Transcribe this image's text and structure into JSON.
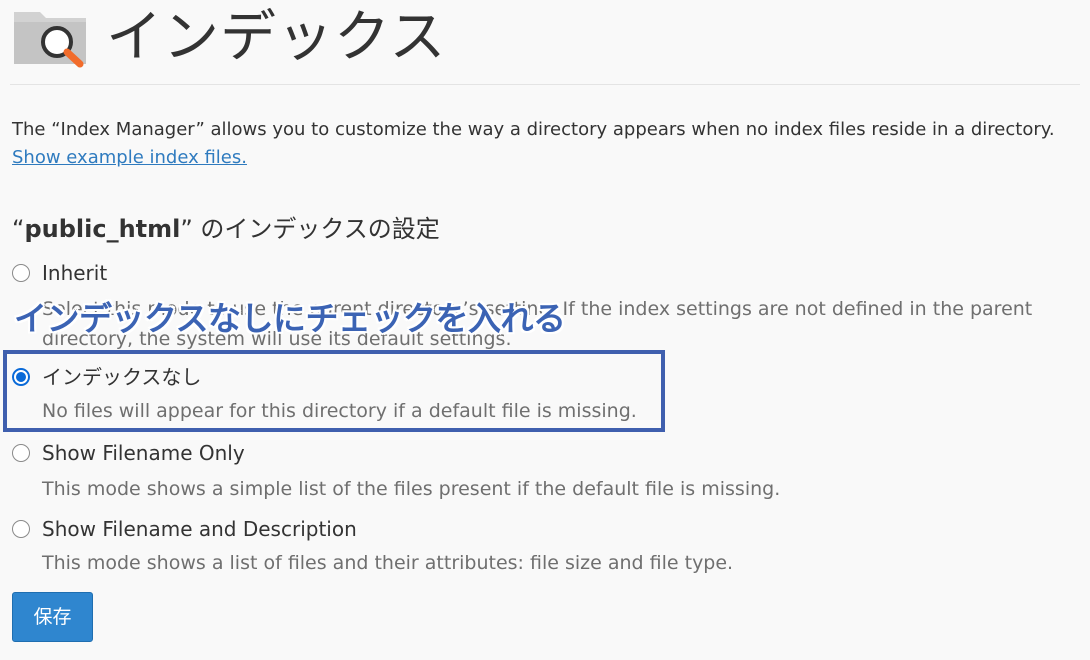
{
  "header": {
    "title": "インデックス",
    "icon": "folder-search-icon"
  },
  "description": {
    "text": "The “Index Manager” allows you to customize the way a directory appears when no index files reside in a directory.",
    "link_label": "Show example index files."
  },
  "section": {
    "quote_open": "“",
    "directory": "public_html",
    "quote_close": "”",
    "title_suffix": " のインデックスの設定"
  },
  "options": [
    {
      "label": "Inherit",
      "hint": "Select this mode to use the parent directory’s setting. If the index settings are not defined in the parent directory, the system will use its default settings.",
      "selected": false
    },
    {
      "label": "インデックスなし",
      "hint": "No files will appear for this directory if a default file is missing.",
      "selected": true
    },
    {
      "label": "Show Filename Only",
      "hint": "This mode shows a simple list of the files present if the default file is missing.",
      "selected": false
    },
    {
      "label": "Show Filename and Description",
      "hint": "This mode shows a list of files and their attributes: file size and file type.",
      "selected": false
    }
  ],
  "annotation": {
    "text": "インデックスなしにチェックを入れる",
    "color": "#3b63b4"
  },
  "save_label": "保存",
  "colors": {
    "accent": "#2f86cf",
    "link": "#2f7bbf",
    "radio_selected": "#0a6ad8"
  }
}
